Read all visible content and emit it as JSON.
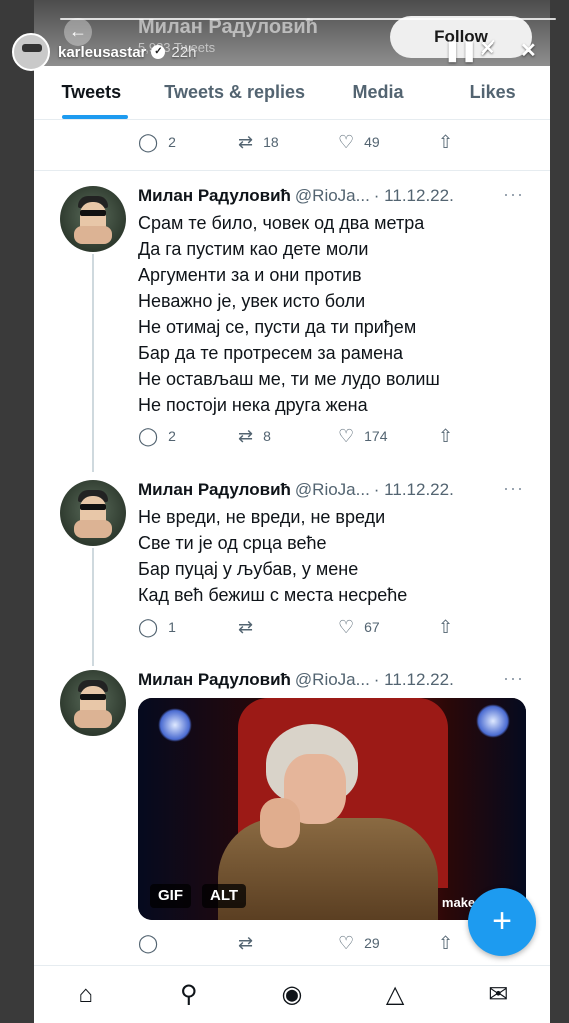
{
  "story": {
    "username": "karleusastar",
    "verified": "✓",
    "time": "22h",
    "pause_icon": "❚❚",
    "mute_icon": "🔇",
    "close_icon": "✕",
    "like_icon": "♡"
  },
  "profile_header": {
    "back_icon": "←",
    "name": "Милан Радуловић",
    "tweet_count": "5,983 Tweets",
    "follow_label": "Follow"
  },
  "tabs": [
    {
      "label": "Tweets",
      "active": true
    },
    {
      "label": "Tweets & replies",
      "active": false
    },
    {
      "label": "Media",
      "active": false
    },
    {
      "label": "Likes",
      "active": false
    }
  ],
  "top_actions": {
    "replies": "2",
    "retweets": "18",
    "likes": "49"
  },
  "icons": {
    "reply": "💬",
    "retweet": "⇄",
    "like": "♡",
    "share": "⇧",
    "more": "···"
  },
  "tweets": [
    {
      "name": "Милан Радуловић",
      "handle": "@RioJa...",
      "date": "· 11.12.22.",
      "lines": [
        "Срам те било, човек од два метра",
        "Да га пустим као дете моли",
        "Аргументи за и они против",
        "Неважно је, увек исто боли",
        "Не отимај се, пусти да ти приђем",
        "Бар да те протресем за рамена",
        " Не остављаш ме, ти ме лудо волиш",
        "Не постоји нека друга жена"
      ],
      "replies": "2",
      "retweets": "8",
      "likes": "174"
    },
    {
      "name": "Милан Радуловић",
      "handle": "@RioJa...",
      "date": "· 11.12.22.",
      "lines": [
        "Не вреди, не вреди, не вреди",
        "Све ти је од срца веће",
        "Бар пуцај у љубав, у мене",
        "Кад већ бежиш с места несреће"
      ],
      "replies": "1",
      "retweets": "",
      "likes": "67"
    },
    {
      "name": "Милан Радуловић",
      "handle": "@RioJa...",
      "date": "· 11.12.22.",
      "gif_badge": "GIF",
      "alt_badge": "ALT",
      "watermark": "make a",
      "replies": "",
      "retweets": "",
      "likes": "29"
    }
  ],
  "fab_icon": "+",
  "bottom_nav": [
    {
      "name": "home-icon",
      "glyph": "⌂"
    },
    {
      "name": "search-icon",
      "glyph": "⚲"
    },
    {
      "name": "spaces-icon",
      "glyph": "◉"
    },
    {
      "name": "notifications-icon",
      "glyph": "🔔"
    },
    {
      "name": "messages-icon",
      "glyph": "✉"
    }
  ]
}
